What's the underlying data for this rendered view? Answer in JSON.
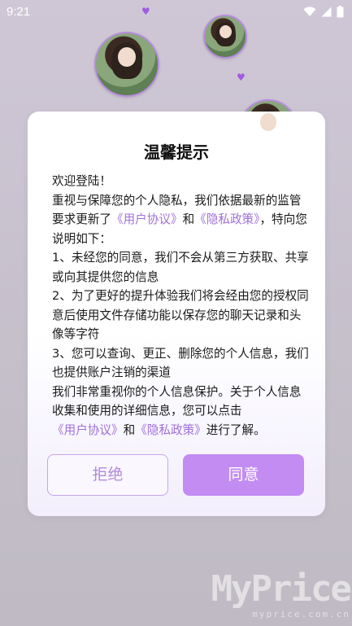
{
  "status_bar": {
    "time": "9:21"
  },
  "dialog": {
    "title": "温馨提示",
    "body": {
      "line1": "欢迎登陆！",
      "para2_pre": "重视与保障您的个人隐私，我们依据最新的监管要求更新了",
      "user_agreement_link": "《用户协议》",
      "and_text": "和",
      "privacy_policy_link": "《隐私政策》",
      "para2_post": "，特向您说明如下：",
      "item1": "1、未经您的同意，我们不会从第三方获取、共享或向其提供您的信息",
      "item2": "2、为了更好的提升体验我们将会经由您的授权同意后使用文件存储功能以保存您的聊天记录和头像等字符",
      "item3": "3、您可以查询、更正、删除您的个人信息，我们也提供账户注销的渠道",
      "closing_pre": "我们非常重视你的个人信息保护。关于个人信息收集和使用的详细信息，您可以点击",
      "closing_post": "进行了解。"
    },
    "reject_label": "拒绝",
    "agree_label": "同意"
  },
  "watermark": {
    "big": "MyPrice",
    "small": "myprice.com.cn"
  },
  "colors": {
    "accent": "#c28cf2",
    "link": "#a070d8",
    "avatar_border": "#b78be0"
  },
  "icons": [
    "wifi-icon",
    "signal-icon",
    "battery-icon",
    "heart-icon"
  ]
}
